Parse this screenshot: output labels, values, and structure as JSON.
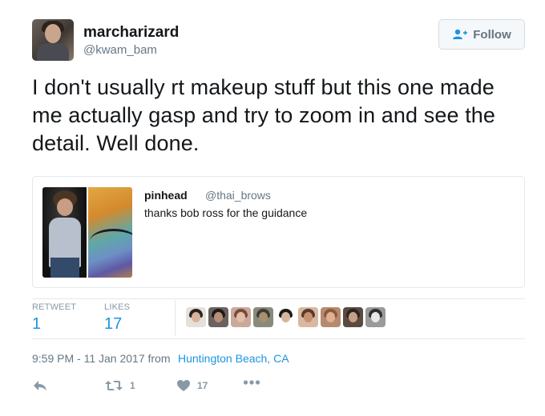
{
  "author": {
    "display_name": "marcharizard",
    "handle": "@kwam_bam"
  },
  "follow_button": {
    "label": "Follow",
    "icon": "follow-person-plus-icon"
  },
  "tweet": {
    "text": "I don't usually rt makeup stuff but this one made me actually gasp and try to zoom in and see the detail. Well done."
  },
  "quoted_tweet": {
    "display_name": "pinhead",
    "handle": "@thai_brows",
    "text": "thanks bob ross for the guidance"
  },
  "stats": {
    "retweets_label": "RETWEET",
    "retweets_value": "1",
    "likes_label": "LIKES",
    "likes_value": "17"
  },
  "likers": [
    {
      "hair": "#2a2320",
      "face": "#d8b29b",
      "bg": "#e6e0da"
    },
    {
      "hair": "#1e1b1a",
      "face": "#b98f77",
      "bg": "#6b6360"
    },
    {
      "hair": "#7a4b3a",
      "face": "#e2bfa6",
      "bg": "#c9a99a"
    },
    {
      "hair": "#3e3b36",
      "face": "#a8906e",
      "bg": "#8a8a7a"
    },
    {
      "hair": "#1a1a1a",
      "face": "#d6b59c",
      "bg": "#ffffff"
    },
    {
      "hair": "#5a3a2a",
      "face": "#c89070",
      "bg": "#d8b8a0"
    },
    {
      "hair": "#8b5a3c",
      "face": "#e0b090",
      "bg": "#b68a70"
    },
    {
      "hair": "#2c2420",
      "face": "#c4a088",
      "bg": "#5a4a40"
    },
    {
      "hair": "#303030",
      "face": "#e8e8e8",
      "bg": "#9a9a9a"
    }
  ],
  "meta": {
    "timestamp": "9:59 PM - 11 Jan 2017 from",
    "location": "Huntington Beach, CA"
  },
  "actions": {
    "reply_icon": "reply-icon",
    "retweet_icon": "retweet-icon",
    "retweet_count": "1",
    "like_icon": "heart-icon",
    "like_count": "17",
    "more_icon": "more-dots-icon"
  },
  "colors": {
    "link": "#1b95e0",
    "muted": "#657786",
    "border": "#e1e8ed"
  }
}
